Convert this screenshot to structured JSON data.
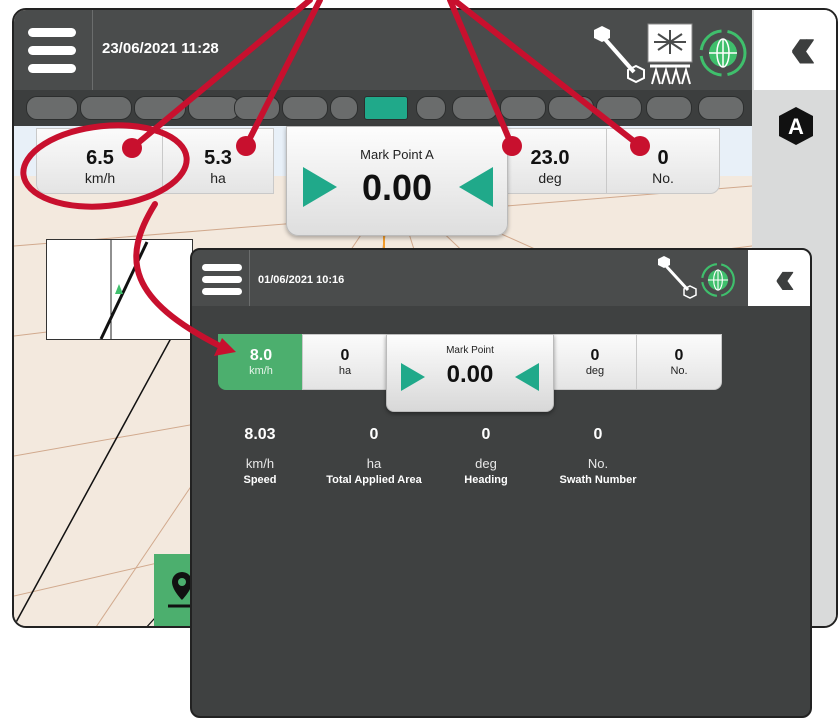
{
  "back_screen": {
    "datetime": "23/06/2021 11:28",
    "mode_badge": "A",
    "dashboard": {
      "speed": {
        "value": "6.5",
        "unit": "km/h"
      },
      "area": {
        "value": "5.3",
        "unit": "ha"
      },
      "mark_point": {
        "label": "Mark Point A",
        "value": "0.00"
      },
      "heading": {
        "value": "23.0",
        "unit": "deg"
      },
      "swath": {
        "value": "0",
        "unit": "No."
      }
    },
    "active_section_index": 7,
    "sections_count": 15
  },
  "front_screen": {
    "datetime": "01/06/2021 10:16",
    "dashboard": {
      "speed": {
        "value": "8.0",
        "unit": "km/h"
      },
      "area": {
        "value": "0",
        "unit": "ha"
      },
      "mark_point": {
        "label": "Mark Point",
        "value": "0.00"
      },
      "heading": {
        "value": "0",
        "unit": "deg"
      },
      "swath": {
        "value": "0",
        "unit": "No."
      }
    },
    "details": [
      {
        "value": "8.03",
        "unit": "km/h",
        "label": "Speed"
      },
      {
        "value": "0",
        "unit": "ha",
        "label": "Total Applied Area"
      },
      {
        "value": "0",
        "unit": "deg",
        "label": "Heading"
      },
      {
        "value": "0",
        "unit": "No.",
        "label": "Swath Number"
      }
    ]
  },
  "icons": {
    "menu": "hamburger-menu-icon",
    "collapse": "double-chevron-left-icon",
    "boom": "boom-sensor-icon",
    "sprayer": "sprayer-icon",
    "gnss": "gnss-globe-icon",
    "mode": "mode-a-hexagon-icon",
    "pin": "location-pin-icon",
    "nav_arrow_right": "guidance-arrow-right-icon",
    "nav_arrow_left": "guidance-arrow-left-icon"
  },
  "colors": {
    "accent_green": "#20a98a",
    "speed_highlight": "#4caf6e",
    "callout_red": "#c8102e",
    "topbar": "#4a4c4c",
    "screen_dark": "#3f4141"
  }
}
